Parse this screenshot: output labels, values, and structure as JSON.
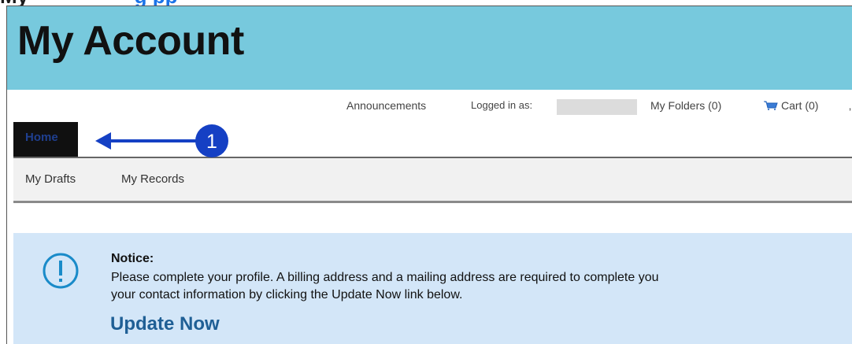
{
  "top_strip": {
    "lead_text": "My",
    "link_text": "g  pp"
  },
  "header": {
    "title": "My Account",
    "background_color": "#77c9dd"
  },
  "utility_nav": {
    "announcements": "Announcements",
    "logged_in_label": "Logged in as:",
    "my_folders": "My Folders (0)",
    "cart": "Cart (0)"
  },
  "tabs": {
    "home": "Home"
  },
  "subnav": {
    "items": [
      {
        "label": "My Drafts"
      },
      {
        "label": "My Records"
      }
    ]
  },
  "callout": {
    "number": "1"
  },
  "notice": {
    "title": "Notice:",
    "message_line1": "Please complete your profile. A billing address and a mailing address are required to complete you",
    "message_line2": "your contact information by clicking the Update Now link below.",
    "link": "Update Now"
  },
  "colors": {
    "accent": "#1f5f95",
    "callout_blue": "#1540c4",
    "notice_bg": "#d3e6f8",
    "tab_bg": "#101010"
  }
}
